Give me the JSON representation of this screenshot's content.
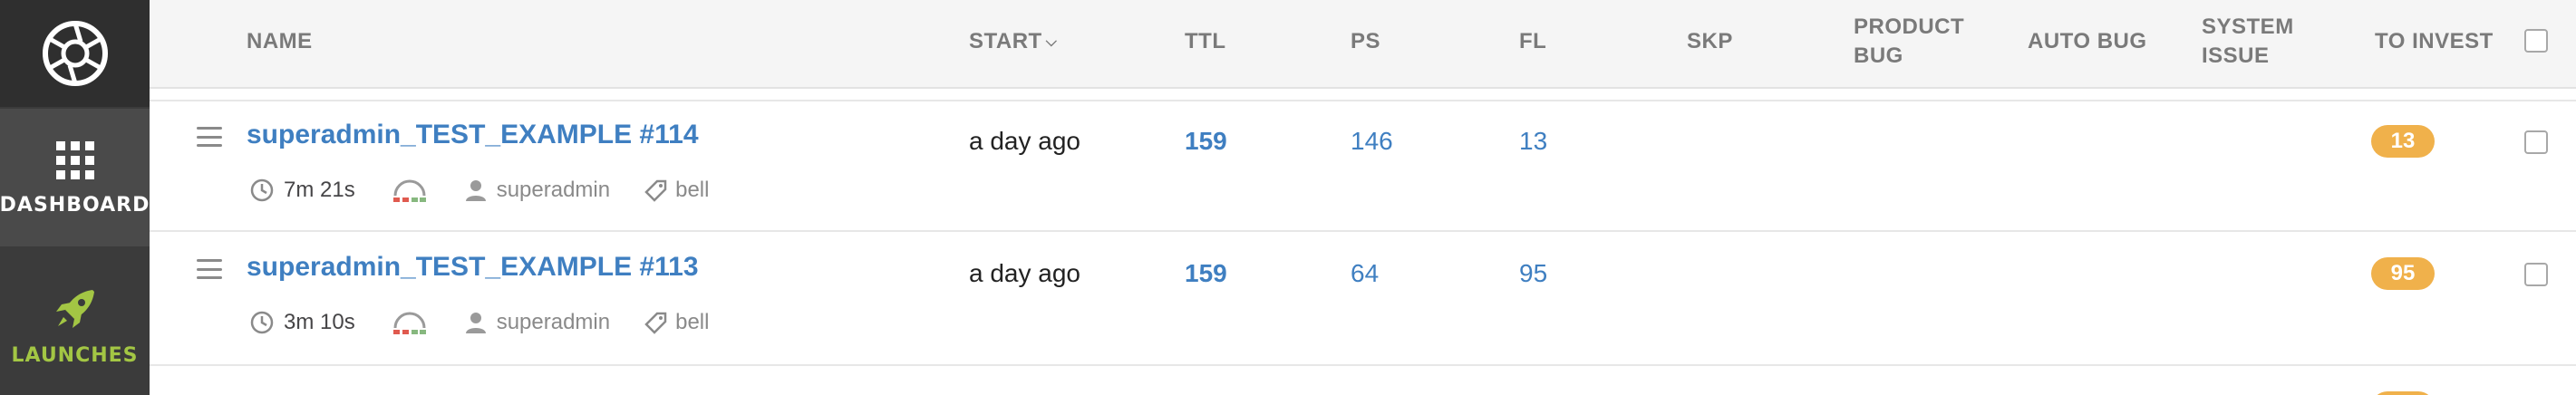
{
  "sidebar": {
    "items": [
      {
        "label": "DASHBOARD",
        "icon": "grid-icon"
      },
      {
        "label": "LAUNCHES",
        "icon": "rocket-icon"
      }
    ],
    "colors": {
      "active_accent": "#a3c644",
      "background": "#3b3b3b"
    }
  },
  "table": {
    "columns": {
      "name": "NAME",
      "start": "START",
      "ttl": "TTL",
      "ps": "PS",
      "fl": "FL",
      "skp": "SKP",
      "product_bug_line1": "PRODUCT",
      "product_bug_line2": "BUG",
      "auto_bug": "AUTO BUG",
      "system_issue_line1": "SYSTEM",
      "system_issue_line2": "ISSUE",
      "to_invest": "TO INVEST"
    },
    "sort_indicator": "chevron-down-icon",
    "rows": [
      {
        "name": "superadmin_TEST_EXAMPLE #114",
        "start": "a day ago",
        "ttl": "159",
        "ps": "146",
        "fl": "13",
        "to_invest": "13",
        "duration": "7m 21s",
        "owner": "superadmin",
        "tag": "bell"
      },
      {
        "name": "superadmin_TEST_EXAMPLE #113",
        "start": "a day ago",
        "ttl": "159",
        "ps": "64",
        "fl": "95",
        "to_invest": "95",
        "duration": "3m 10s",
        "owner": "superadmin",
        "tag": "bell"
      }
    ]
  },
  "colors": {
    "link": "#3f7fc1",
    "badge": "#f0b14b",
    "failed": "#e05a4f",
    "passed": "#87b87f"
  }
}
